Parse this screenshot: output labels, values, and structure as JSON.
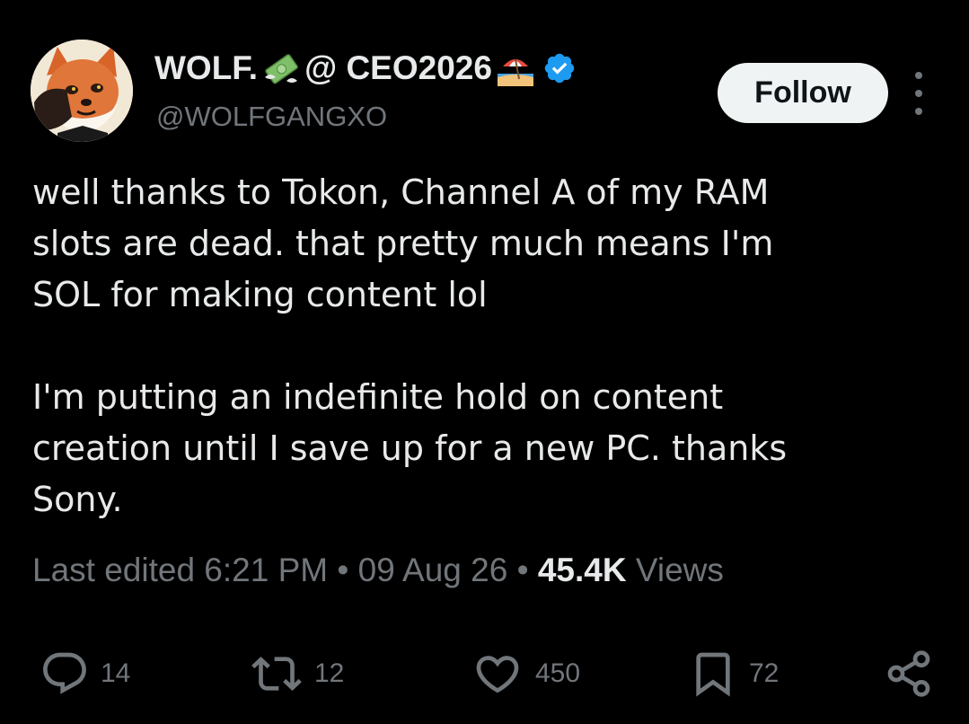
{
  "author": {
    "display_name_part1": "WOLF.",
    "display_name_part2": "@ CEO2026",
    "emoji_1": "money-with-wings-icon",
    "emoji_2": "beach-umbrella-icon",
    "verified": "verified-badge-icon",
    "handle": "@WOLFGANGXO"
  },
  "follow_label": "Follow",
  "text": {
    "paragraph1_line1": "well thanks to Tokon, Channel A of my RAM",
    "paragraph1_line2": "slots are dead. that pretty much means I'm",
    "paragraph1_line3": "SOL for making content lol",
    "paragraph2_line1": "I'm putting an indefinite hold on content",
    "paragraph2_line2": "creation until I save up for a new PC. thanks",
    "paragraph2_line3": "Sony."
  },
  "meta": {
    "edited_label": "Last edited 6:21 PM",
    "separator": "•",
    "date": "09 Aug 26",
    "views_count": "45.4K",
    "views_label": "Views"
  },
  "actions": {
    "replies": "14",
    "reposts": "12",
    "likes": "450",
    "bookmarks": "72"
  },
  "colors": {
    "background": "#000000",
    "primary_text": "#e7e9ea",
    "secondary_text": "#71767b",
    "verified_blue": "#1d9bf0",
    "follow_bg": "#eff3f4"
  }
}
